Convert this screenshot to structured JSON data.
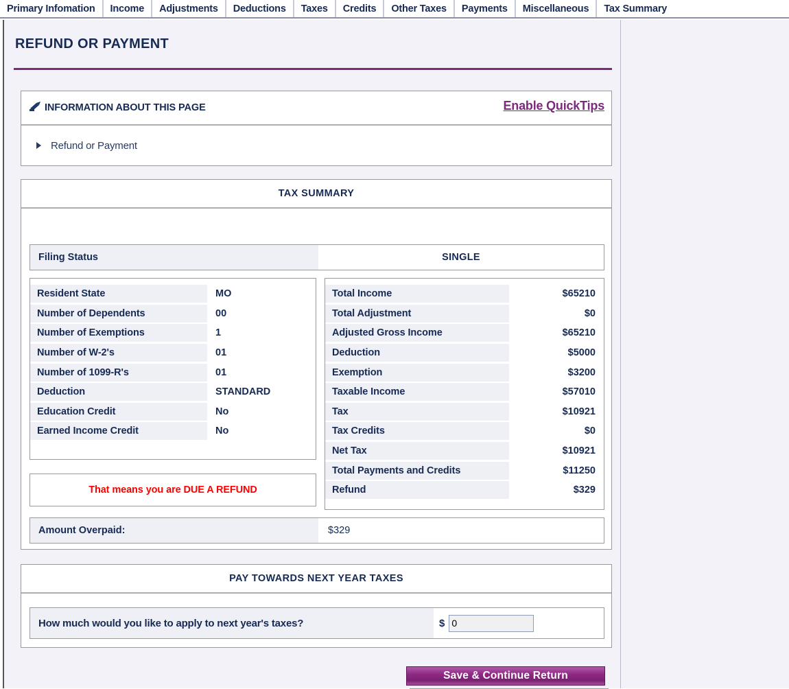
{
  "tabs": [
    {
      "label": "Primary Infomation"
    },
    {
      "label": "Income"
    },
    {
      "label": "Adjustments"
    },
    {
      "label": "Deductions"
    },
    {
      "label": "Taxes"
    },
    {
      "label": "Credits"
    },
    {
      "label": "Other Taxes"
    },
    {
      "label": "Payments"
    },
    {
      "label": "Miscellaneous"
    },
    {
      "label": "Tax Summary"
    }
  ],
  "page": {
    "title": "REFUND OR PAYMENT"
  },
  "info": {
    "icon": "pen-icon",
    "heading": "INFORMATION ABOUT THIS PAGE",
    "quicktips_label": "Enable QuickTips",
    "collapsible_label": "Refund or Payment",
    "collapse_icon": "triangle-right-icon"
  },
  "tax_summary": {
    "section_title": "TAX SUMMARY",
    "filing_status": {
      "label": "Filing Status",
      "value": "SINGLE"
    },
    "left_rows": [
      {
        "key": "Resident State",
        "value": "MO"
      },
      {
        "key": "Number of Dependents",
        "value": "00"
      },
      {
        "key": "Number of Exemptions",
        "value": "1"
      },
      {
        "key": "Number of W-2's",
        "value": "01"
      },
      {
        "key": "Number of 1099-R's",
        "value": "01"
      },
      {
        "key": "Deduction",
        "value": "STANDARD"
      },
      {
        "key": "Education Credit",
        "value": "No"
      },
      {
        "key": "Earned Income Credit",
        "value": "No"
      }
    ],
    "right_rows": [
      {
        "key": "Total Income",
        "value": "$65210"
      },
      {
        "key": "Total Adjustment",
        "value": "$0"
      },
      {
        "key": "Adjusted Gross Income",
        "value": "$65210"
      },
      {
        "key": "Deduction",
        "value": "$5000"
      },
      {
        "key": "Exemption",
        "value": "$3200"
      },
      {
        "key": "Taxable Income",
        "value": "$57010"
      },
      {
        "key": "Tax",
        "value": "$10921"
      },
      {
        "key": "Tax Credits",
        "value": "$0"
      },
      {
        "key": "Net Tax",
        "value": "$10921"
      },
      {
        "key": "Total Payments and Credits",
        "value": "$11250"
      },
      {
        "key": "Refund",
        "value": "$329"
      }
    ],
    "refund_message": "That means you are DUE A REFUND",
    "amount_overpaid": {
      "label": "Amount Overpaid:",
      "value": "$329"
    }
  },
  "next_year": {
    "section_title": "PAY TOWARDS NEXT YEAR TAXES",
    "question": "How much would you like to apply to next year's taxes?",
    "currency_symbol": "$",
    "input_value": "0"
  },
  "footer": {
    "save_label": "Save & Continue Return"
  },
  "colors": {
    "accent_purple": "#7c2a7c",
    "heading_navy": "#172a54",
    "alert_red": "#ff0000",
    "row_fill": "#eef0f5"
  }
}
